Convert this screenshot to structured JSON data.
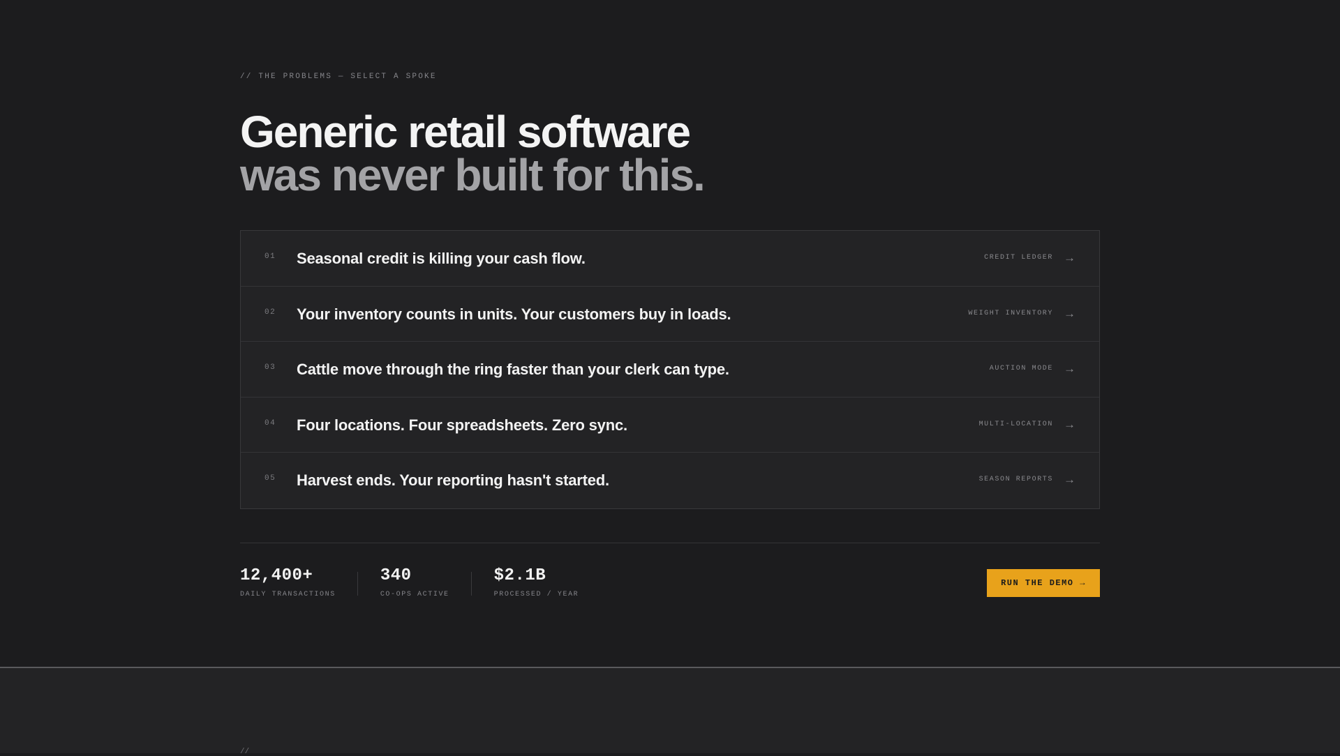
{
  "eyebrow": "// THE PROBLEMS — SELECT A SPOKE",
  "headline": {
    "line1": "Generic retail software",
    "line2": "was never built for this."
  },
  "problems": [
    {
      "num": "01",
      "title": "Seasonal credit is killing your cash flow.",
      "tag": "CREDIT LEDGER",
      "arrow": "→"
    },
    {
      "num": "02",
      "title": "Your inventory counts in units. Your customers buy in loads.",
      "tag": "WEIGHT INVENTORY",
      "arrow": "→"
    },
    {
      "num": "03",
      "title": "Cattle move through the ring faster than your clerk can type.",
      "tag": "AUCTION MODE",
      "arrow": "→"
    },
    {
      "num": "04",
      "title": "Four locations. Four spreadsheets. Zero sync.",
      "tag": "MULTI-LOCATION",
      "arrow": "→"
    },
    {
      "num": "05",
      "title": "Harvest ends. Your reporting hasn't started.",
      "tag": "SEASON REPORTS",
      "arrow": "→"
    }
  ],
  "stats": [
    {
      "value": "12,400+",
      "label": "DAILY TRANSACTIONS"
    },
    {
      "value": "340",
      "label": "CO-OPS ACTIVE"
    },
    {
      "value": "$2.1B",
      "label": "PROCESSED / YEAR"
    }
  ],
  "cta": {
    "label": "RUN THE DEMO →"
  },
  "next_section": {
    "partial_text": "//"
  },
  "colors": {
    "accent": "#e8a21b",
    "background": "#1c1c1e",
    "panel": "#232325"
  }
}
